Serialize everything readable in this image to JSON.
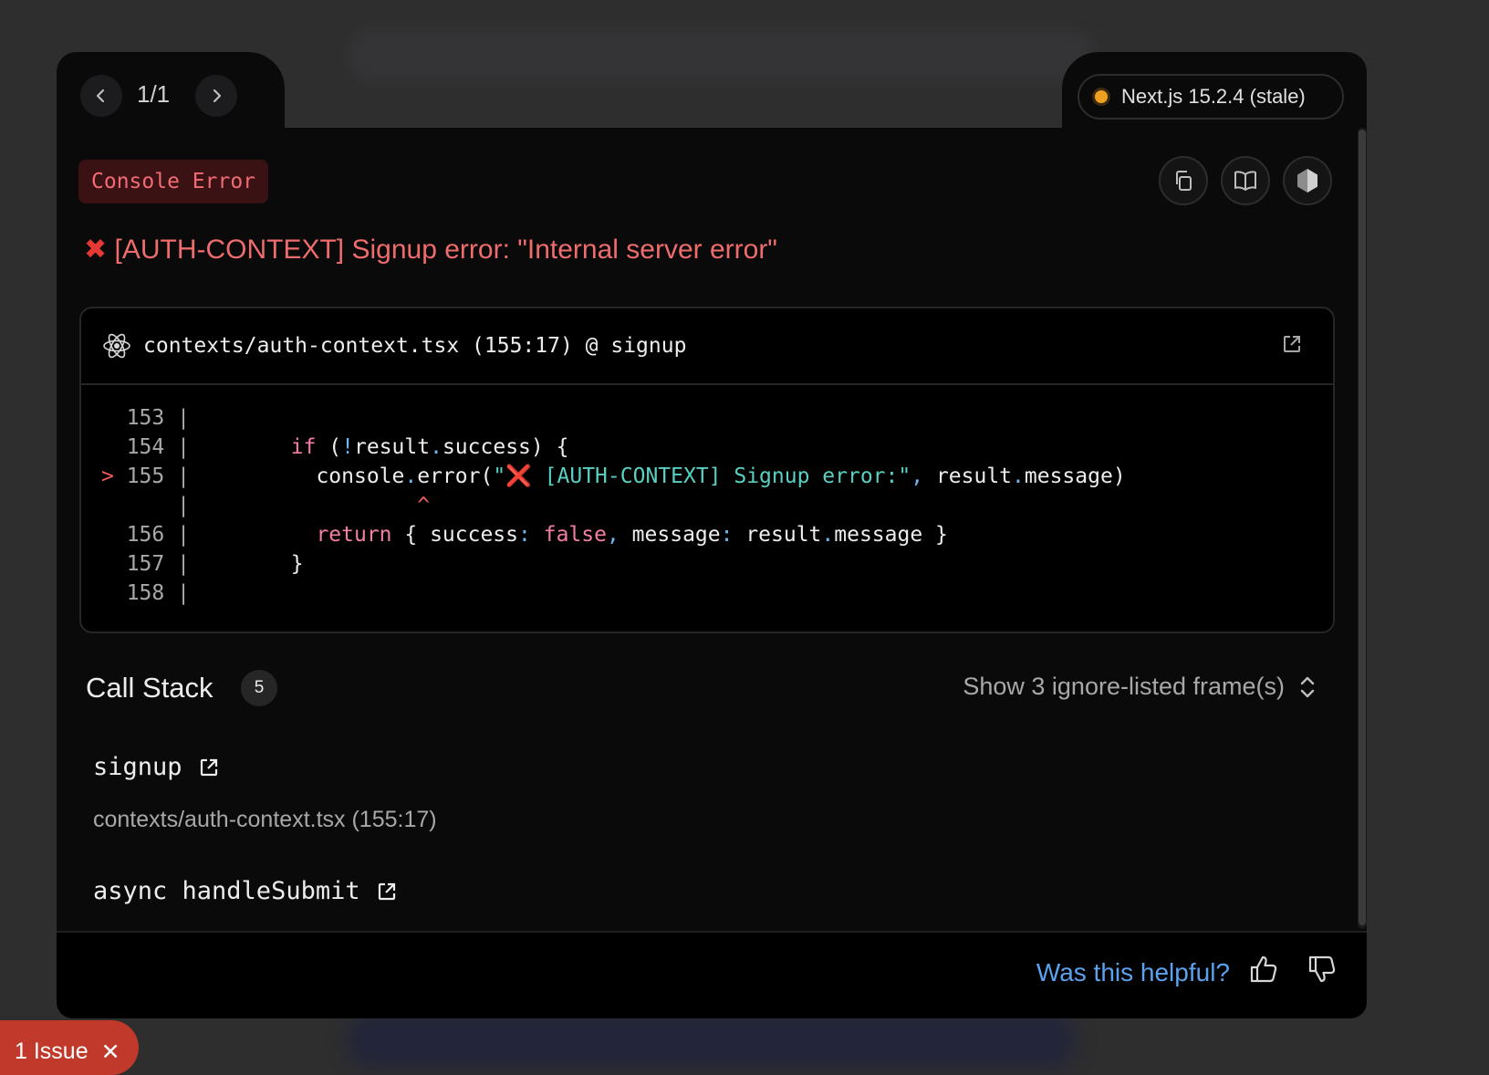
{
  "nav": {
    "pager": "1/1"
  },
  "version": {
    "label": "Next.js 15.2.4 (stale)",
    "status_color": "#f0a020"
  },
  "error": {
    "badge": "Console Error",
    "icon": "cross-mark-icon",
    "title": "[AUTH-CONTEXT] Signup error: \"Internal server error\""
  },
  "toolbar": {
    "copy_icon": "copy-icon",
    "docs_icon": "book-icon",
    "nodejs_icon": "hexagon-icon"
  },
  "code_frame": {
    "file_label": "contexts/auth-context.tsx (155:17) @ signup",
    "lines": [
      {
        "marker": "  ",
        "number": "153",
        "sep": " |",
        "code": ""
      },
      {
        "marker": "  ",
        "number": "154",
        "sep": " |",
        "code_kw": "if",
        "code_rest_a": " (",
        "code_punc_a": "!",
        "code_rest_b": "result",
        "code_punc_b": ".",
        "code_rest_c": "success) {"
      },
      {
        "marker": "> ",
        "number": "155",
        "sep": " |",
        "code_a": "console",
        "code_punc_a": ".",
        "code_b": "error(",
        "code_str": "\"❌ [AUTH-CONTEXT] Signup error:\"",
        "code_punc_b": ",",
        "code_c": " result",
        "code_punc_c": ".",
        "code_d": "message)"
      },
      {
        "marker": "  ",
        "number": "   ",
        "sep": " |",
        "caret": "^"
      },
      {
        "marker": "  ",
        "number": "156",
        "sep": " |",
        "code_kw": "return",
        "code_a": " { success",
        "code_punc_a": ":",
        "code_kw2": " false",
        "code_punc_b": ",",
        "code_b": " message",
        "code_punc_c": ":",
        "code_c": " result",
        "code_punc_d": ".",
        "code_d": "message }"
      },
      {
        "marker": "  ",
        "number": "157",
        "sep": " |",
        "code": "}"
      },
      {
        "marker": "  ",
        "number": "158",
        "sep": " |",
        "code": ""
      }
    ]
  },
  "call_stack": {
    "title": "Call Stack",
    "count": "5",
    "ignore_toggle": "Show 3 ignore-listed frame(s)",
    "frames": [
      {
        "name": "signup",
        "location": "contexts/auth-context.tsx (155:17)"
      },
      {
        "name": "async handleSubmit"
      }
    ]
  },
  "footer": {
    "helpful": "Was this helpful?"
  },
  "issues": {
    "label": "1 Issue"
  }
}
